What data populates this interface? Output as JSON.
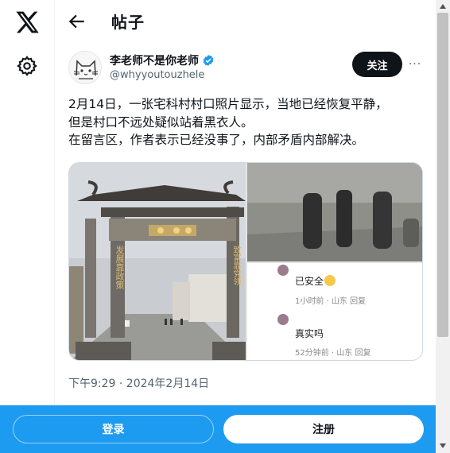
{
  "header": {
    "title": "帖子"
  },
  "author": {
    "name": "李老师不是你老师",
    "handle": "@whyyoutouzhele"
  },
  "actions": {
    "follow_label": "关注",
    "more_label": "···"
  },
  "tweet": {
    "lines": [
      "2月14日，一张宅科村村口照片显示，当地已经恢复平静，",
      "但是村口不远处疑似站着黑衣人。",
      "在留言区，作者表示已经没事了，内部矛盾内部解决。"
    ],
    "timestamp": "下午9:29 · 2024年2月14日"
  },
  "media": {
    "gate_left_sign": "发展靠政策",
    "gate_right_sign": "致富靠党领",
    "comments": [
      {
        "text": "已安全",
        "meta": "1小时前 · 山东   回复"
      },
      {
        "text": "真实吗",
        "meta": "52分钟前 · 山东   回复"
      }
    ]
  },
  "footer": {
    "login_label": "登录",
    "signup_label": "注册"
  },
  "colors": {
    "accent": "#1d9bf0",
    "text": "#0f1419",
    "muted": "#536471"
  },
  "icons": [
    "x-logo-icon",
    "gear-icon",
    "back-arrow-icon",
    "verified-badge-icon",
    "more-icon"
  ]
}
